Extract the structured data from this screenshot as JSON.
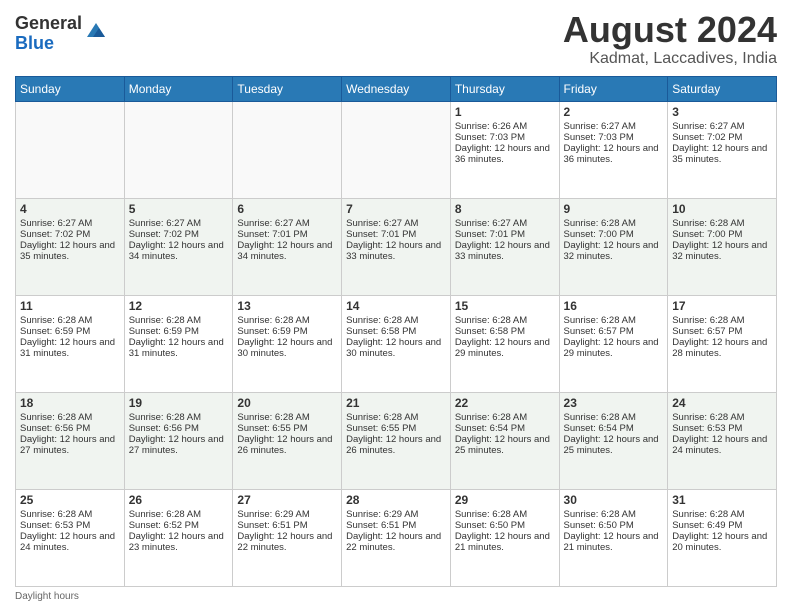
{
  "logo": {
    "general": "General",
    "blue": "Blue"
  },
  "title": "August 2024",
  "subtitle": "Kadmat, Laccadives, India",
  "days": [
    "Sunday",
    "Monday",
    "Tuesday",
    "Wednesday",
    "Thursday",
    "Friday",
    "Saturday"
  ],
  "footer": "Daylight hours",
  "weeks": [
    [
      {
        "date": "",
        "sunrise": "",
        "sunset": "",
        "daylight": "",
        "empty": true
      },
      {
        "date": "",
        "sunrise": "",
        "sunset": "",
        "daylight": "",
        "empty": true
      },
      {
        "date": "",
        "sunrise": "",
        "sunset": "",
        "daylight": "",
        "empty": true
      },
      {
        "date": "",
        "sunrise": "",
        "sunset": "",
        "daylight": "",
        "empty": true
      },
      {
        "date": "1",
        "sunrise": "Sunrise: 6:26 AM",
        "sunset": "Sunset: 7:03 PM",
        "daylight": "Daylight: 12 hours and 36 minutes.",
        "empty": false
      },
      {
        "date": "2",
        "sunrise": "Sunrise: 6:27 AM",
        "sunset": "Sunset: 7:03 PM",
        "daylight": "Daylight: 12 hours and 36 minutes.",
        "empty": false
      },
      {
        "date": "3",
        "sunrise": "Sunrise: 6:27 AM",
        "sunset": "Sunset: 7:02 PM",
        "daylight": "Daylight: 12 hours and 35 minutes.",
        "empty": false
      }
    ],
    [
      {
        "date": "4",
        "sunrise": "Sunrise: 6:27 AM",
        "sunset": "Sunset: 7:02 PM",
        "daylight": "Daylight: 12 hours and 35 minutes.",
        "empty": false
      },
      {
        "date": "5",
        "sunrise": "Sunrise: 6:27 AM",
        "sunset": "Sunset: 7:02 PM",
        "daylight": "Daylight: 12 hours and 34 minutes.",
        "empty": false
      },
      {
        "date": "6",
        "sunrise": "Sunrise: 6:27 AM",
        "sunset": "Sunset: 7:01 PM",
        "daylight": "Daylight: 12 hours and 34 minutes.",
        "empty": false
      },
      {
        "date": "7",
        "sunrise": "Sunrise: 6:27 AM",
        "sunset": "Sunset: 7:01 PM",
        "daylight": "Daylight: 12 hours and 33 minutes.",
        "empty": false
      },
      {
        "date": "8",
        "sunrise": "Sunrise: 6:27 AM",
        "sunset": "Sunset: 7:01 PM",
        "daylight": "Daylight: 12 hours and 33 minutes.",
        "empty": false
      },
      {
        "date": "9",
        "sunrise": "Sunrise: 6:28 AM",
        "sunset": "Sunset: 7:00 PM",
        "daylight": "Daylight: 12 hours and 32 minutes.",
        "empty": false
      },
      {
        "date": "10",
        "sunrise": "Sunrise: 6:28 AM",
        "sunset": "Sunset: 7:00 PM",
        "daylight": "Daylight: 12 hours and 32 minutes.",
        "empty": false
      }
    ],
    [
      {
        "date": "11",
        "sunrise": "Sunrise: 6:28 AM",
        "sunset": "Sunset: 6:59 PM",
        "daylight": "Daylight: 12 hours and 31 minutes.",
        "empty": false
      },
      {
        "date": "12",
        "sunrise": "Sunrise: 6:28 AM",
        "sunset": "Sunset: 6:59 PM",
        "daylight": "Daylight: 12 hours and 31 minutes.",
        "empty": false
      },
      {
        "date": "13",
        "sunrise": "Sunrise: 6:28 AM",
        "sunset": "Sunset: 6:59 PM",
        "daylight": "Daylight: 12 hours and 30 minutes.",
        "empty": false
      },
      {
        "date": "14",
        "sunrise": "Sunrise: 6:28 AM",
        "sunset": "Sunset: 6:58 PM",
        "daylight": "Daylight: 12 hours and 30 minutes.",
        "empty": false
      },
      {
        "date": "15",
        "sunrise": "Sunrise: 6:28 AM",
        "sunset": "Sunset: 6:58 PM",
        "daylight": "Daylight: 12 hours and 29 minutes.",
        "empty": false
      },
      {
        "date": "16",
        "sunrise": "Sunrise: 6:28 AM",
        "sunset": "Sunset: 6:57 PM",
        "daylight": "Daylight: 12 hours and 29 minutes.",
        "empty": false
      },
      {
        "date": "17",
        "sunrise": "Sunrise: 6:28 AM",
        "sunset": "Sunset: 6:57 PM",
        "daylight": "Daylight: 12 hours and 28 minutes.",
        "empty": false
      }
    ],
    [
      {
        "date": "18",
        "sunrise": "Sunrise: 6:28 AM",
        "sunset": "Sunset: 6:56 PM",
        "daylight": "Daylight: 12 hours and 27 minutes.",
        "empty": false
      },
      {
        "date": "19",
        "sunrise": "Sunrise: 6:28 AM",
        "sunset": "Sunset: 6:56 PM",
        "daylight": "Daylight: 12 hours and 27 minutes.",
        "empty": false
      },
      {
        "date": "20",
        "sunrise": "Sunrise: 6:28 AM",
        "sunset": "Sunset: 6:55 PM",
        "daylight": "Daylight: 12 hours and 26 minutes.",
        "empty": false
      },
      {
        "date": "21",
        "sunrise": "Sunrise: 6:28 AM",
        "sunset": "Sunset: 6:55 PM",
        "daylight": "Daylight: 12 hours and 26 minutes.",
        "empty": false
      },
      {
        "date": "22",
        "sunrise": "Sunrise: 6:28 AM",
        "sunset": "Sunset: 6:54 PM",
        "daylight": "Daylight: 12 hours and 25 minutes.",
        "empty": false
      },
      {
        "date": "23",
        "sunrise": "Sunrise: 6:28 AM",
        "sunset": "Sunset: 6:54 PM",
        "daylight": "Daylight: 12 hours and 25 minutes.",
        "empty": false
      },
      {
        "date": "24",
        "sunrise": "Sunrise: 6:28 AM",
        "sunset": "Sunset: 6:53 PM",
        "daylight": "Daylight: 12 hours and 24 minutes.",
        "empty": false
      }
    ],
    [
      {
        "date": "25",
        "sunrise": "Sunrise: 6:28 AM",
        "sunset": "Sunset: 6:53 PM",
        "daylight": "Daylight: 12 hours and 24 minutes.",
        "empty": false
      },
      {
        "date": "26",
        "sunrise": "Sunrise: 6:28 AM",
        "sunset": "Sunset: 6:52 PM",
        "daylight": "Daylight: 12 hours and 23 minutes.",
        "empty": false
      },
      {
        "date": "27",
        "sunrise": "Sunrise: 6:29 AM",
        "sunset": "Sunset: 6:51 PM",
        "daylight": "Daylight: 12 hours and 22 minutes.",
        "empty": false
      },
      {
        "date": "28",
        "sunrise": "Sunrise: 6:29 AM",
        "sunset": "Sunset: 6:51 PM",
        "daylight": "Daylight: 12 hours and 22 minutes.",
        "empty": false
      },
      {
        "date": "29",
        "sunrise": "Sunrise: 6:28 AM",
        "sunset": "Sunset: 6:50 PM",
        "daylight": "Daylight: 12 hours and 21 minutes.",
        "empty": false
      },
      {
        "date": "30",
        "sunrise": "Sunrise: 6:28 AM",
        "sunset": "Sunset: 6:50 PM",
        "daylight": "Daylight: 12 hours and 21 minutes.",
        "empty": false
      },
      {
        "date": "31",
        "sunrise": "Sunrise: 6:28 AM",
        "sunset": "Sunset: 6:49 PM",
        "daylight": "Daylight: 12 hours and 20 minutes.",
        "empty": false
      }
    ]
  ]
}
